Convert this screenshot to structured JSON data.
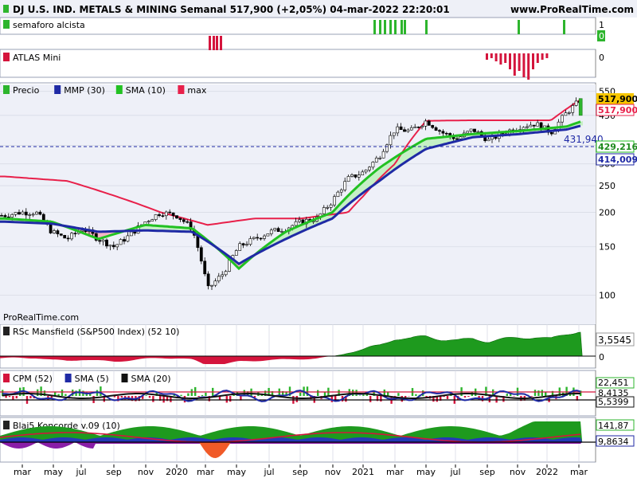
{
  "header": {
    "title": "DJ U.S. IND. METALS & MINING Semanal 517,900 (+2,05%) 04-mar-2022 22:20:01",
    "site": "www.ProRealTime.com"
  },
  "watermark": "ProRealTime.com",
  "colors": {
    "grid": "#d8dbe6",
    "panel_bg": "#e9ecf7",
    "up": "#2db52d",
    "down": "#d4143c",
    "mmp": "#1f2aa5",
    "sma_green": "#22c122",
    "max_red": "#e8204a",
    "area_green": "#c6f0c6",
    "area_red": "#f5b5c5",
    "dark_green": "#1e8a1e"
  },
  "x_ticks": [
    "mar",
    "may",
    "jul",
    "sep",
    "nov",
    "2020",
    "mar",
    "may",
    "jul",
    "sep",
    "nov",
    "2021",
    "mar",
    "may",
    "jul",
    "sep",
    "nov",
    "2022",
    "mar"
  ],
  "panels": {
    "semaforo": {
      "label": "semaforo alcista",
      "ticks": [
        "1",
        "0"
      ]
    },
    "atlas": {
      "label": "ATLAS Mini",
      "ticks": [
        "0"
      ]
    },
    "price": {
      "legend": [
        {
          "label": "Precio",
          "color": "#2db52d"
        },
        {
          "label": "MMP (30)",
          "color": "#1f2aa5"
        },
        {
          "label": "SMA (10)",
          "color": "#22c122"
        },
        {
          "label": "max",
          "color": "#e8204a"
        }
      ],
      "yticks": [
        "550",
        "450",
        "350",
        "300",
        "250",
        "200",
        "150",
        "100"
      ],
      "badges": {
        "last": "517,900",
        "max": "517,900",
        "sma": "429,216",
        "mmp": "414,009"
      },
      "ref_label": "431,940"
    },
    "rsc": {
      "label": "RSc Mansfield (S&P500 Index) (52 10)",
      "value": "3,5545",
      "zero": "0"
    },
    "cpm": {
      "legend": [
        {
          "label": "CPM (52)",
          "color": "#d4143c"
        },
        {
          "label": "SMA (5)",
          "color": "#1f2aa5"
        },
        {
          "label": "SMA (20)",
          "color": "#111111"
        }
      ],
      "values": [
        "22,451",
        "8,4135",
        "5,5399"
      ]
    },
    "koncorde": {
      "label": "Blai5 Koncorde v.09 (10)",
      "values": [
        "141,87",
        "9,8634"
      ]
    }
  },
  "chart_data": {
    "type": "line",
    "title": "DJ U.S. IND. METALS & MINING Semanal 517,900 (+2,05%) 04-mar-2022 22:20:01",
    "x_range": [
      "2019-02",
      "2022-03"
    ],
    "y_scale": "log",
    "ylim": [
      85,
      560
    ],
    "series": [
      {
        "name": "Precio",
        "x": [
          "2019-02",
          "2019-03",
          "2019-04",
          "2019-05",
          "2019-06",
          "2019-07",
          "2019-08",
          "2019-09",
          "2019-10",
          "2019-11",
          "2019-12",
          "2020-01",
          "2020-02",
          "2020-03",
          "2020-04",
          "2020-05",
          "2020-06",
          "2020-07",
          "2020-08",
          "2020-09",
          "2020-10",
          "2020-11",
          "2020-12",
          "2021-01",
          "2021-02",
          "2021-03",
          "2021-04",
          "2021-05",
          "2021-06",
          "2021-07",
          "2021-08",
          "2021-09",
          "2021-10",
          "2021-11",
          "2021-12",
          "2022-01",
          "2022-02",
          "2022-03"
        ],
        "values": [
          195,
          200,
          200,
          170,
          160,
          175,
          160,
          150,
          165,
          185,
          200,
          195,
          175,
          105,
          120,
          150,
          160,
          170,
          175,
          185,
          190,
          220,
          265,
          280,
          320,
          400,
          395,
          430,
          390,
          370,
          400,
          365,
          390,
          410,
          420,
          390,
          460,
          517.9
        ]
      },
      {
        "name": "MMP (30)",
        "x": [
          "2019-02",
          "2019-05",
          "2019-08",
          "2019-11",
          "2020-02",
          "2020-05",
          "2020-08",
          "2020-11",
          "2021-02",
          "2021-05",
          "2021-08",
          "2021-11",
          "2022-02",
          "2022-03"
        ],
        "values": [
          185,
          182,
          170,
          172,
          170,
          130,
          160,
          190,
          260,
          340,
          375,
          385,
          400,
          414
        ]
      },
      {
        "name": "SMA (10)",
        "x": [
          "2019-02",
          "2019-05",
          "2019-08",
          "2019-11",
          "2020-02",
          "2020-05",
          "2020-08",
          "2020-11",
          "2021-02",
          "2021-05",
          "2021-08",
          "2021-11",
          "2022-02",
          "2022-03"
        ],
        "values": [
          190,
          185,
          160,
          180,
          175,
          125,
          170,
          200,
          290,
          370,
          385,
          395,
          410,
          429
        ]
      },
      {
        "name": "max",
        "x": [
          "2019-02",
          "2019-06",
          "2019-09",
          "2019-12",
          "2020-03",
          "2020-06",
          "2020-09",
          "2020-12",
          "2021-01",
          "2021-03",
          "2021-05",
          "2021-08",
          "2021-11",
          "2022-01",
          "2022-03"
        ],
        "values": [
          270,
          260,
          230,
          200,
          180,
          190,
          190,
          200,
          230,
          300,
          430,
          432,
          432,
          432,
          517.9
        ]
      }
    ],
    "reference_line": 431.94,
    "last_value": 517.9
  }
}
